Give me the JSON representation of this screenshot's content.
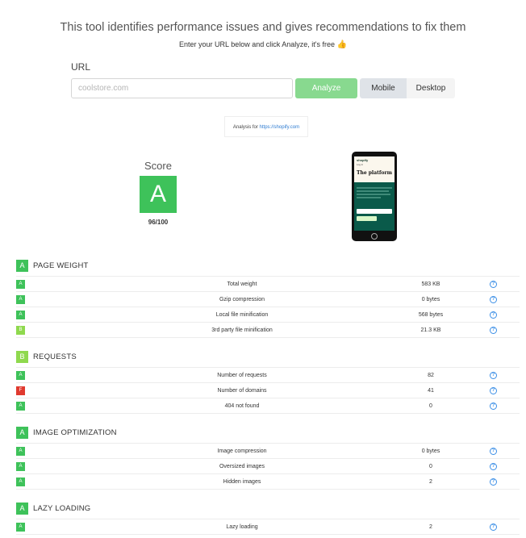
{
  "header": {
    "title": "This tool identifies performance issues and gives recommendations to fix them",
    "subtitle": "Enter your URL below and click Analyze, it's free",
    "subtitle_icon": "thumbs-up-icon"
  },
  "form": {
    "url_label": "URL",
    "url_placeholder": "coolstore.com",
    "url_value": "",
    "analyze_label": "Analyze",
    "mobile_label": "Mobile",
    "desktop_label": "Desktop",
    "selected_device": "Mobile"
  },
  "analysis": {
    "prefix": "Analysis for",
    "url": "https://shopify.com"
  },
  "score": {
    "label": "Score",
    "grade": "A",
    "value": "96/100"
  },
  "preview": {
    "logo": "shopify",
    "menu": "Log in",
    "title": "The platform"
  },
  "colors": {
    "A": "#3ec25a",
    "B": "#8fd94e",
    "F": "#e03a2f",
    "accent_button": "#88d98f",
    "help": "#3a8ee6"
  },
  "sections": [
    {
      "title": "PAGE WEIGHT",
      "grade": "A",
      "rows": [
        {
          "grade": "A",
          "label": "Total weight",
          "value": "583 KB"
        },
        {
          "grade": "A",
          "label": "Gzip compression",
          "value": "0 bytes"
        },
        {
          "grade": "A",
          "label": "Local file minification",
          "value": "568 bytes"
        },
        {
          "grade": "B",
          "label": "3rd party file minification",
          "value": "21.3 KB"
        }
      ]
    },
    {
      "title": "REQUESTS",
      "grade": "B",
      "rows": [
        {
          "grade": "A",
          "label": "Number of requests",
          "value": "82"
        },
        {
          "grade": "F",
          "label": "Number of domains",
          "value": "41"
        },
        {
          "grade": "A",
          "label": "404 not found",
          "value": "0"
        }
      ]
    },
    {
      "title": "IMAGE OPTIMIZATION",
      "grade": "A",
      "rows": [
        {
          "grade": "A",
          "label": "Image compression",
          "value": "0 bytes"
        },
        {
          "grade": "A",
          "label": "Oversized images",
          "value": "0"
        },
        {
          "grade": "A",
          "label": "Hidden images",
          "value": "2"
        }
      ]
    },
    {
      "title": "LAZY LOADING",
      "grade": "A",
      "rows": [
        {
          "grade": "A",
          "label": "Lazy loading",
          "value": "2"
        }
      ]
    }
  ]
}
